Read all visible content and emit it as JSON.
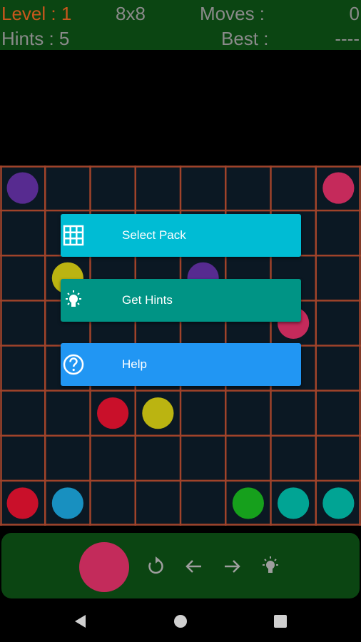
{
  "header": {
    "level_label": "Level : 1",
    "grid_size": "8x8",
    "moves_label": "Moves :",
    "moves_value": "0",
    "hints_label": "Hints : 5",
    "best_label": "Best :",
    "best_value": "----"
  },
  "board": {
    "rows": 8,
    "cols": 8,
    "grid_color": "#a0432a",
    "cell_color": "#0b1823",
    "dots": [
      {
        "row": 0,
        "col": 0,
        "color": "#572b90"
      },
      {
        "row": 0,
        "col": 7,
        "color": "#c52a5b"
      },
      {
        "row": 2,
        "col": 1,
        "color": "#bbb411"
      },
      {
        "row": 2,
        "col": 4,
        "color": "#572b90"
      },
      {
        "row": 3,
        "col": 6,
        "color": "#c52a5b"
      },
      {
        "row": 5,
        "col": 2,
        "color": "#c9102a"
      },
      {
        "row": 5,
        "col": 3,
        "color": "#bbb411"
      },
      {
        "row": 7,
        "col": 0,
        "color": "#c9102a"
      },
      {
        "row": 7,
        "col": 1,
        "color": "#1890c0"
      },
      {
        "row": 7,
        "col": 5,
        "color": "#16a01c"
      },
      {
        "row": 7,
        "col": 6,
        "color": "#01a494"
      },
      {
        "row": 7,
        "col": 7,
        "color": "#01a494"
      }
    ]
  },
  "menu": {
    "select_pack": {
      "label": "Select Pack",
      "icon": "grid-icon",
      "color": "#00bcd4"
    },
    "get_hints": {
      "label": "Get Hints",
      "icon": "lightbulb-icon",
      "color": "#009485"
    },
    "help": {
      "label": "Help",
      "icon": "help-circle-icon",
      "color": "#2196f3"
    }
  },
  "controls": {
    "current_color": "#c32b5b",
    "icons": [
      "undo-icon",
      "arrow-left-icon",
      "arrow-right-icon",
      "hint-bulb-icon"
    ]
  },
  "colors": {
    "header_bg": "#0b4512",
    "level_text": "#c8571d",
    "header_text": "#8a8a8a"
  }
}
